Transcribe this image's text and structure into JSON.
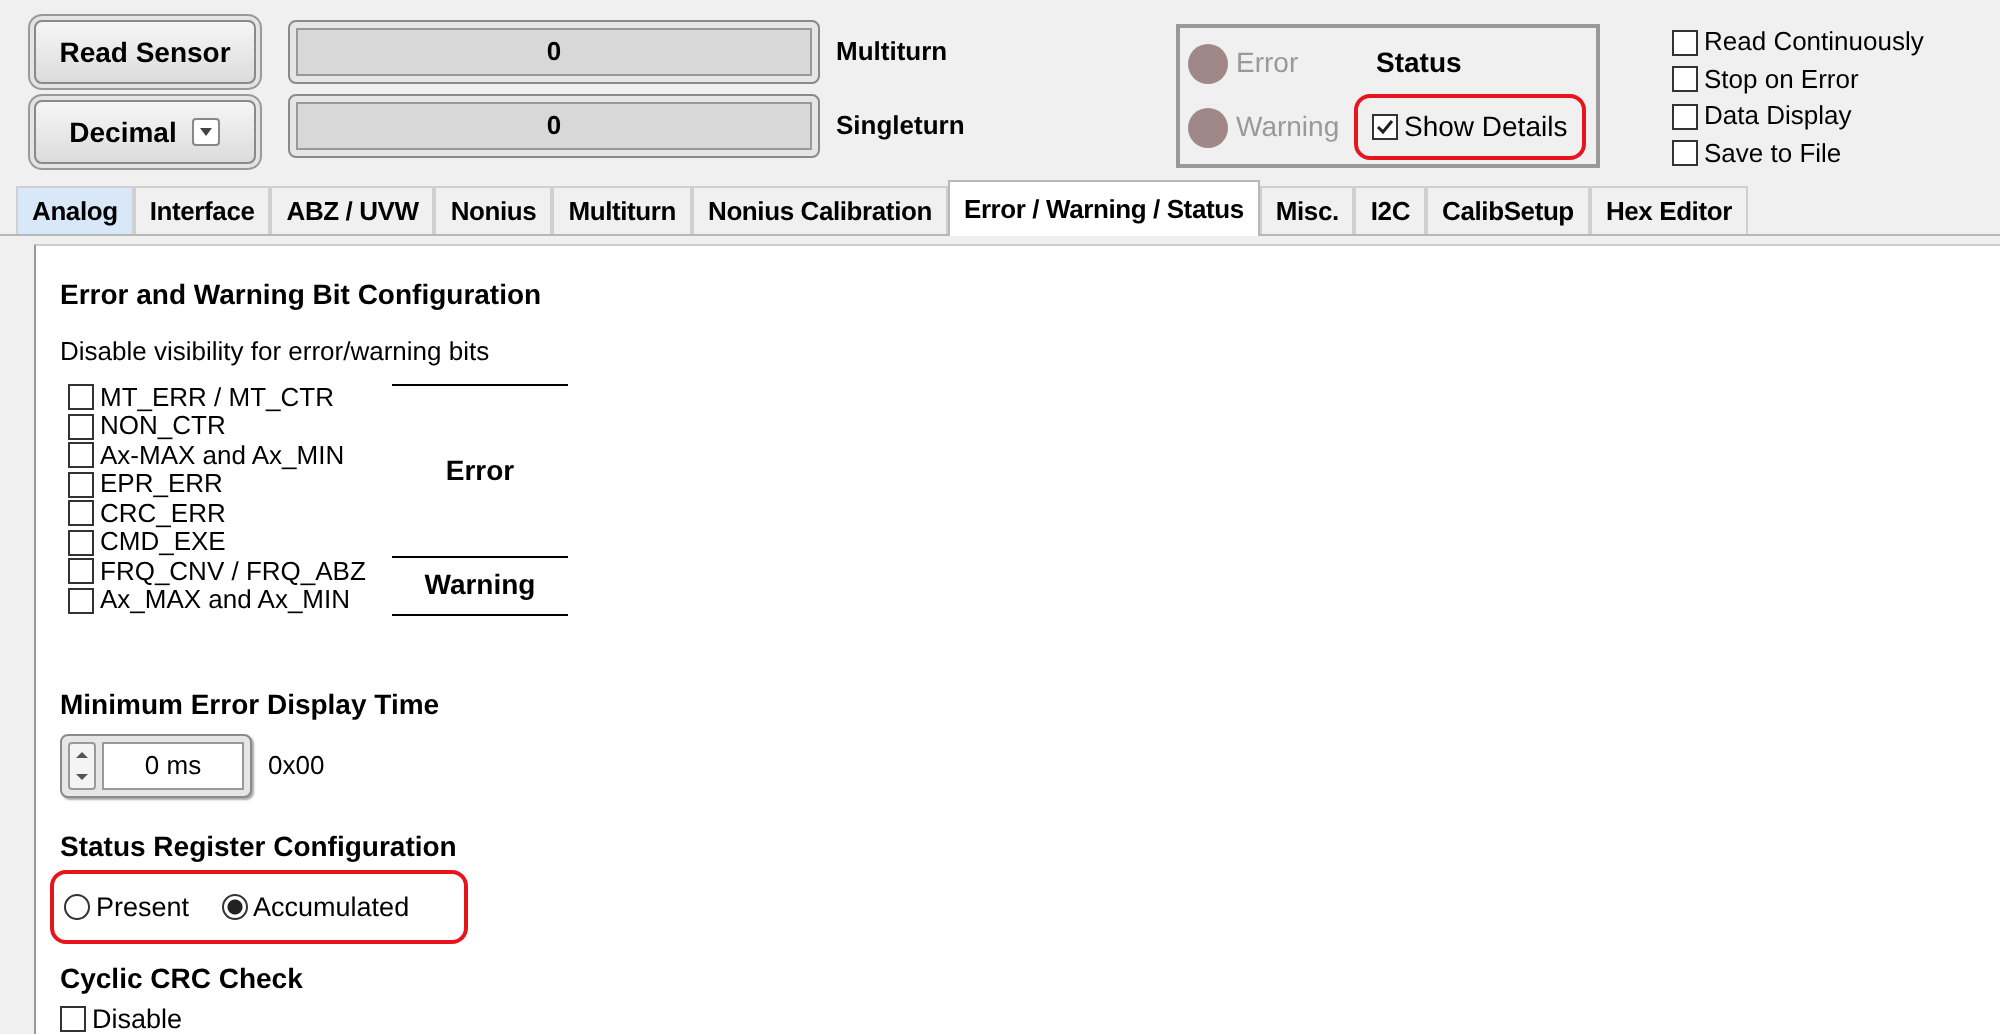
{
  "read_button": {
    "label": "Read Sensor"
  },
  "format_button": {
    "label": "Decimal"
  },
  "readouts": [
    {
      "value": "0",
      "label": "Multiturn"
    },
    {
      "value": "0",
      "label": "Singleturn"
    }
  ],
  "status": {
    "title": "Status",
    "indicators": [
      {
        "label": "Error",
        "on": false
      },
      {
        "label": "Warning",
        "on": false
      }
    ],
    "show_details": {
      "label": "Show Details",
      "checked": true,
      "highlighted": true
    }
  },
  "options": [
    {
      "label": "Read Continuously",
      "checked": false
    },
    {
      "label": "Stop on Error",
      "checked": false
    },
    {
      "label": "Data Display",
      "checked": false
    },
    {
      "label": "Save to File",
      "checked": false
    }
  ],
  "tabs": [
    {
      "label": "Analog",
      "selected": false,
      "hovered": true
    },
    {
      "label": "Interface",
      "selected": false,
      "hovered": false
    },
    {
      "label": "ABZ / UVW",
      "selected": false,
      "hovered": false
    },
    {
      "label": "Nonius",
      "selected": false,
      "hovered": false
    },
    {
      "label": "Multiturn",
      "selected": false,
      "hovered": false
    },
    {
      "label": "Nonius Calibration",
      "selected": false,
      "hovered": false
    },
    {
      "label": "Error / Warning / Status",
      "selected": true,
      "hovered": false
    },
    {
      "label": "Misc.",
      "selected": false,
      "hovered": false
    },
    {
      "label": "I2C",
      "selected": false,
      "hovered": false
    },
    {
      "label": "CalibSetup",
      "selected": false,
      "hovered": false
    },
    {
      "label": "Hex Editor",
      "selected": false,
      "hovered": false
    }
  ],
  "bit_config": {
    "title": "Error and Warning Bit Configuration",
    "subtitle": "Disable visibility for error/warning bits",
    "groups": [
      {
        "label": "Error",
        "bits": [
          {
            "label": "MT_ERR / MT_CTR",
            "checked": false
          },
          {
            "label": "NON_CTR",
            "checked": false
          },
          {
            "label": "Ax-MAX and Ax_MIN",
            "checked": false
          },
          {
            "label": "EPR_ERR",
            "checked": false
          },
          {
            "label": "CRC_ERR",
            "checked": false
          },
          {
            "label": "CMD_EXE",
            "checked": false
          }
        ]
      },
      {
        "label": "Warning",
        "bits": [
          {
            "label": "FRQ_CNV / FRQ_ABZ",
            "checked": false
          },
          {
            "label": "Ax_MAX and Ax_MIN",
            "checked": false
          }
        ]
      }
    ]
  },
  "display_time": {
    "title": "Minimum Error Display Time",
    "value": "0 ms",
    "hex": "0x00"
  },
  "status_register": {
    "title": "Status Register Configuration",
    "highlighted": true,
    "options": [
      {
        "label": "Present",
        "selected": false
      },
      {
        "label": "Accumulated",
        "selected": true
      }
    ]
  },
  "crc_check": {
    "title": "Cyclic CRC Check",
    "option": {
      "label": "Disable",
      "checked": false
    }
  }
}
